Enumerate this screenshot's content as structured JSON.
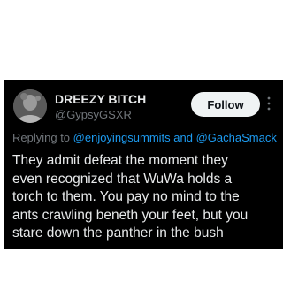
{
  "tweet": {
    "display_name": "DREEZY BITCH",
    "handle": "@GypsyGSXR",
    "follow_label": "Follow",
    "replying_prefix": "Replying to ",
    "mention_1": "@enjoyingsummits",
    "conjunction": " and ",
    "mention_2": "@GachaSmack",
    "text_lines": [
      "They admit defeat the moment they",
      "even recognized that WuWa holds a",
      "torch to them. You pay no mind to the",
      "ants crawling beneth your feet, but you",
      "stare down the panther in the bush"
    ]
  },
  "colors": {
    "card_background": "#000000",
    "primary_text": "#e7e9ea",
    "secondary_text": "#71767b",
    "link": "#1d9bf0",
    "follow_button_bg": "#eff3f4",
    "follow_button_text": "#0f1419"
  },
  "icons": {
    "more": "more-vertical-icon",
    "avatar": "avatar"
  }
}
